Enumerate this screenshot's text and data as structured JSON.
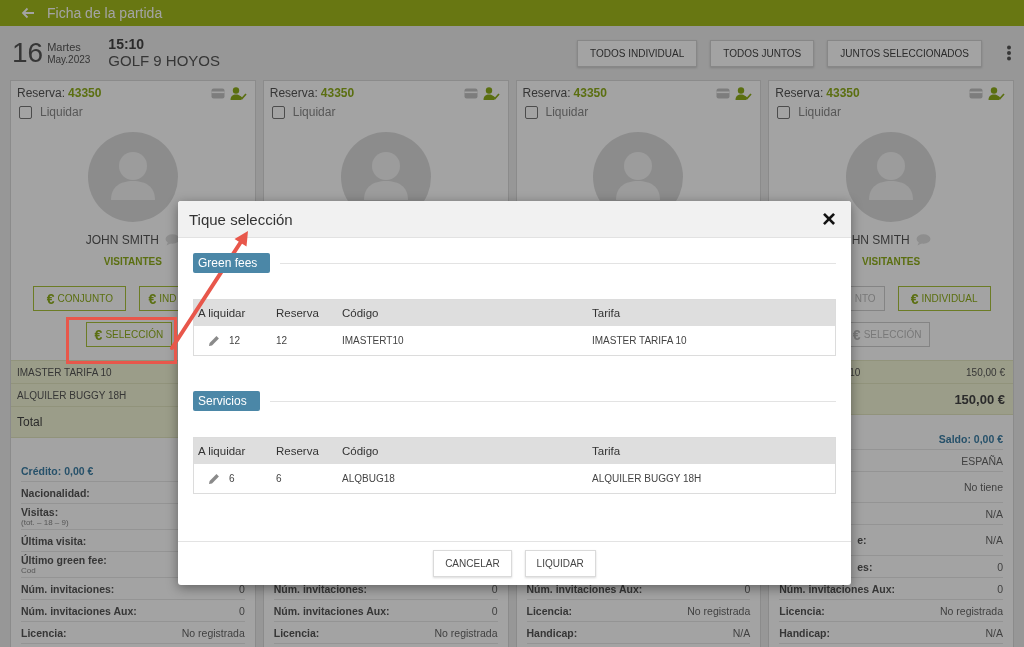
{
  "header": {
    "title": "Ficha de la partida"
  },
  "match": {
    "day": "16",
    "weekday": "Martes",
    "month_year": "May.2023",
    "time": "15:10",
    "course": "GOLF 9 HOYOS"
  },
  "actions": [
    "TODOS INDIVIDUAL",
    "TODOS JUNTOS",
    "JUNTOS SELECCIONADOS"
  ],
  "cards": [
    {
      "reserva_label": "Reserva:",
      "reserva": "43350",
      "liquidar": {
        "label": "Liquidar",
        "checked": false
      },
      "name": "JOHN SMITH",
      "category": "VISITANTES",
      "buttons": [
        {
          "symbol": "€",
          "label": "CONJUNTO",
          "disabled": false
        },
        {
          "symbol": "€",
          "label": "IND",
          "disabled": false
        }
      ],
      "selection": {
        "symbol": "€",
        "label": "SELECCIÓN",
        "disabled": false
      },
      "summary": {
        "items": [
          {
            "label": "IMASTER TARIFA 10"
          },
          {
            "label": "ALQUILER BUGGY 18H"
          }
        ],
        "total": {
          "label": "Total"
        }
      },
      "details": [
        {
          "kind": "balance",
          "label": "Crédito: 0,00 €"
        },
        {
          "kind": "field",
          "label": "Nacionalidad:"
        },
        {
          "kind": "field",
          "label": "Visitas:",
          "note": "(tot. – 18 – 9)"
        },
        {
          "kind": "field",
          "label": "Última visita:"
        },
        {
          "kind": "field",
          "label": "Último green fee:",
          "note": "Cod"
        },
        {
          "kind": "field",
          "label": "Núm. invitaciones:",
          "value": "0"
        },
        {
          "kind": "field",
          "label": "Núm. invitaciones Aux:",
          "value": "0"
        },
        {
          "kind": "field",
          "label": "Licencia:",
          "value": "No registrada"
        }
      ]
    },
    {
      "reserva_label": "Reserva:",
      "reserva": "43350",
      "liquidar": {
        "label": "Liquidar",
        "checked": false
      },
      "details": [
        {
          "kind": "field",
          "label": "Núm. invitaciones:",
          "value": "0"
        },
        {
          "kind": "field",
          "label": "Núm. invitaciones Aux:",
          "value": "0"
        },
        {
          "kind": "field",
          "label": "Licencia:",
          "value": "No registrada"
        }
      ]
    },
    {
      "reserva_label": "Reserva:",
      "reserva": "43350",
      "liquidar": {
        "label": "Liquidar",
        "checked": false
      },
      "details": [
        {
          "kind": "field",
          "label": "Núm. invitaciones Aux:",
          "value": "0"
        },
        {
          "kind": "field",
          "label": "Licencia:",
          "value": "No registrada"
        },
        {
          "kind": "field",
          "label": "Handicap:",
          "value": "N/A"
        }
      ]
    },
    {
      "reserva_label": "Reserva:",
      "reserva": "43350",
      "liquidar": {
        "label": "Liquidar",
        "checked": false
      },
      "name": "HN SMITH",
      "category": "VISITANTES",
      "buttons": [
        {
          "label": "NTO",
          "disabled": true
        },
        {
          "symbol": "€",
          "label": "INDIVIDUAL",
          "disabled": false
        }
      ],
      "selection": {
        "symbol": "€",
        "label": "SELECCIÓN",
        "disabled": true
      },
      "summary": {
        "items": [
          {
            "label": "10",
            "value": "150,00 €"
          }
        ],
        "total": {
          "value": "150,00 €"
        }
      },
      "details": [
        {
          "kind": "balance",
          "value": "Saldo: 0,00 €"
        },
        {
          "kind": "field",
          "value": "ESPAÑA"
        },
        {
          "kind": "field",
          "value": "No tiene"
        },
        {
          "kind": "field",
          "value": "N/A"
        },
        {
          "kind": "field",
          "label": "e:",
          "value": "N/A"
        },
        {
          "kind": "field",
          "label": "es:",
          "value": "0"
        },
        {
          "kind": "field",
          "label": "Núm. invitaciones Aux:",
          "value": "0"
        },
        {
          "kind": "field",
          "label": "Licencia:",
          "value": "No registrada"
        },
        {
          "kind": "field",
          "label": "Handicap:",
          "value": "N/A"
        }
      ]
    }
  ],
  "modal": {
    "title": "Tique selección",
    "close": "×",
    "sections": [
      {
        "title": "Green fees",
        "columns": [
          "A liquidar",
          "Reserva",
          "Código",
          "Tarifa"
        ],
        "rows": [
          [
            "12",
            "12",
            "IMASTERT10",
            "IMASTER TARIFA 10"
          ]
        ]
      },
      {
        "title": "Servicios",
        "columns": [
          "A liquidar",
          "Reserva",
          "Código",
          "Tarifa"
        ],
        "rows": [
          [
            "6",
            "6",
            "ALQBUG18",
            "ALQUILER BUGGY 18H"
          ]
        ]
      }
    ],
    "buttons": [
      "CANCELAR",
      "LIQUIDAR"
    ]
  }
}
